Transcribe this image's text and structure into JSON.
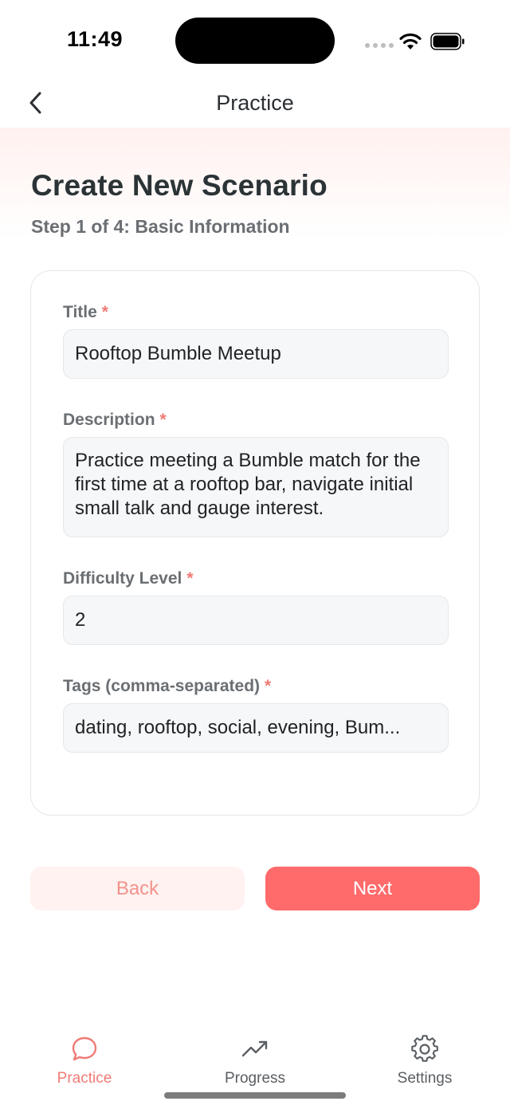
{
  "status_bar": {
    "time": "11:49"
  },
  "header": {
    "title": "Practice",
    "back_icon": "chevron-left-icon"
  },
  "page": {
    "title": "Create New Scenario",
    "subtitle": "Step 1 of 4: Basic Information"
  },
  "form": {
    "required_mark": "*",
    "title": {
      "label": "Title",
      "value": "Rooftop Bumble Meetup"
    },
    "description": {
      "label": "Description",
      "value": "Practice meeting a Bumble match for the first time at a rooftop bar, navigate initial small talk and gauge interest."
    },
    "difficulty": {
      "label": "Difficulty Level",
      "value": "2"
    },
    "tags": {
      "label": "Tags (comma-separated)",
      "value": "dating, rooftop, social, evening, Bum..."
    }
  },
  "actions": {
    "back_label": "Back",
    "next_label": "Next"
  },
  "tabs": [
    {
      "label": "Practice",
      "icon": "chat-bubble-icon",
      "active": true
    },
    {
      "label": "Progress",
      "icon": "trending-up-icon",
      "active": false
    },
    {
      "label": "Settings",
      "icon": "gear-icon",
      "active": false
    }
  ],
  "colors": {
    "accent": "#ff6b6b",
    "accent_light": "#fff2f0",
    "required": "#ef7b75",
    "text_dark": "#2b3336",
    "text_muted": "#6b6f73"
  }
}
